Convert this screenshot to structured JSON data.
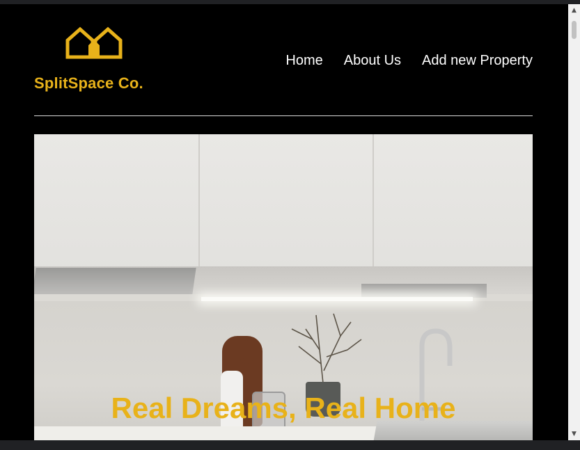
{
  "brand": {
    "name": "SplitSpace Co.",
    "icon": "house-outline-icon",
    "color": "#e8b21a"
  },
  "nav": {
    "items": [
      {
        "label": "Home"
      },
      {
        "label": "About Us"
      },
      {
        "label": "Add new Property"
      }
    ]
  },
  "hero": {
    "title": "Real Dreams, Real Home",
    "image": "kitchen-photo"
  },
  "scrollbar": {
    "up_icon": "scroll-up-arrow-icon",
    "down_icon": "scroll-down-arrow-icon"
  },
  "colors": {
    "background": "#000000",
    "accent": "#e8b21a",
    "nav_text": "#ffffff"
  }
}
